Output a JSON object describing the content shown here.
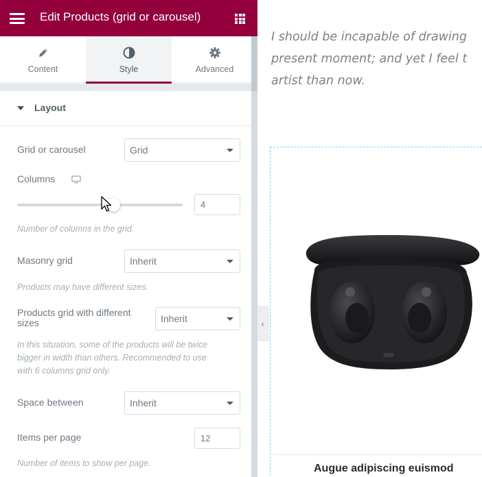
{
  "header": {
    "title": "Edit Products (grid or carousel)",
    "menu_icon": "hamburger-menu-icon",
    "apps_icon": "grid-apps-icon",
    "background": "#93003c"
  },
  "tabs": [
    {
      "label": "Content",
      "icon": "pencil-icon",
      "active": false
    },
    {
      "label": "Style",
      "icon": "contrast-circle-icon",
      "active": true
    },
    {
      "label": "Advanced",
      "icon": "gear-icon",
      "active": false
    }
  ],
  "section": {
    "title": "Layout",
    "expanded": true
  },
  "controls": {
    "grid_or_carousel": {
      "label": "Grid or carousel",
      "value": "Grid"
    },
    "columns": {
      "label": "Columns",
      "device_icon": "desktop-monitor-icon",
      "value": "4",
      "slider_fraction": 0.58,
      "description": "Number of columns in the grid."
    },
    "masonry_grid": {
      "label": "Masonry grid",
      "value": "Inherit",
      "description": "Products may have different sizes."
    },
    "products_grid_different_sizes": {
      "label_line1": "Products grid with different",
      "label_line2": "sizes",
      "value": "Inherit",
      "description_lines": [
        "In this situation, some of the products will be twice",
        "bigger in width than others. Recommended to use",
        "with 6 columns grid only."
      ]
    },
    "space_between": {
      "label": "Space between",
      "value": "Inherit"
    },
    "items_per_page": {
      "label": "Items per page",
      "value": "12",
      "description": "Number of items to show per page."
    }
  },
  "preview": {
    "quote_lines": [
      "I should be incapable of drawing",
      "present moment; and yet I feel t",
      "artist than now."
    ],
    "collapse_icon": "chevron-left-icon",
    "product_image": "wireless-earbuds-case-image",
    "product_title": "Augue adipiscing euismod"
  },
  "colors": {
    "accent": "#93003c",
    "label": "#6d7882",
    "description": "#a4afb7",
    "card_outline": "#71d7f7"
  }
}
